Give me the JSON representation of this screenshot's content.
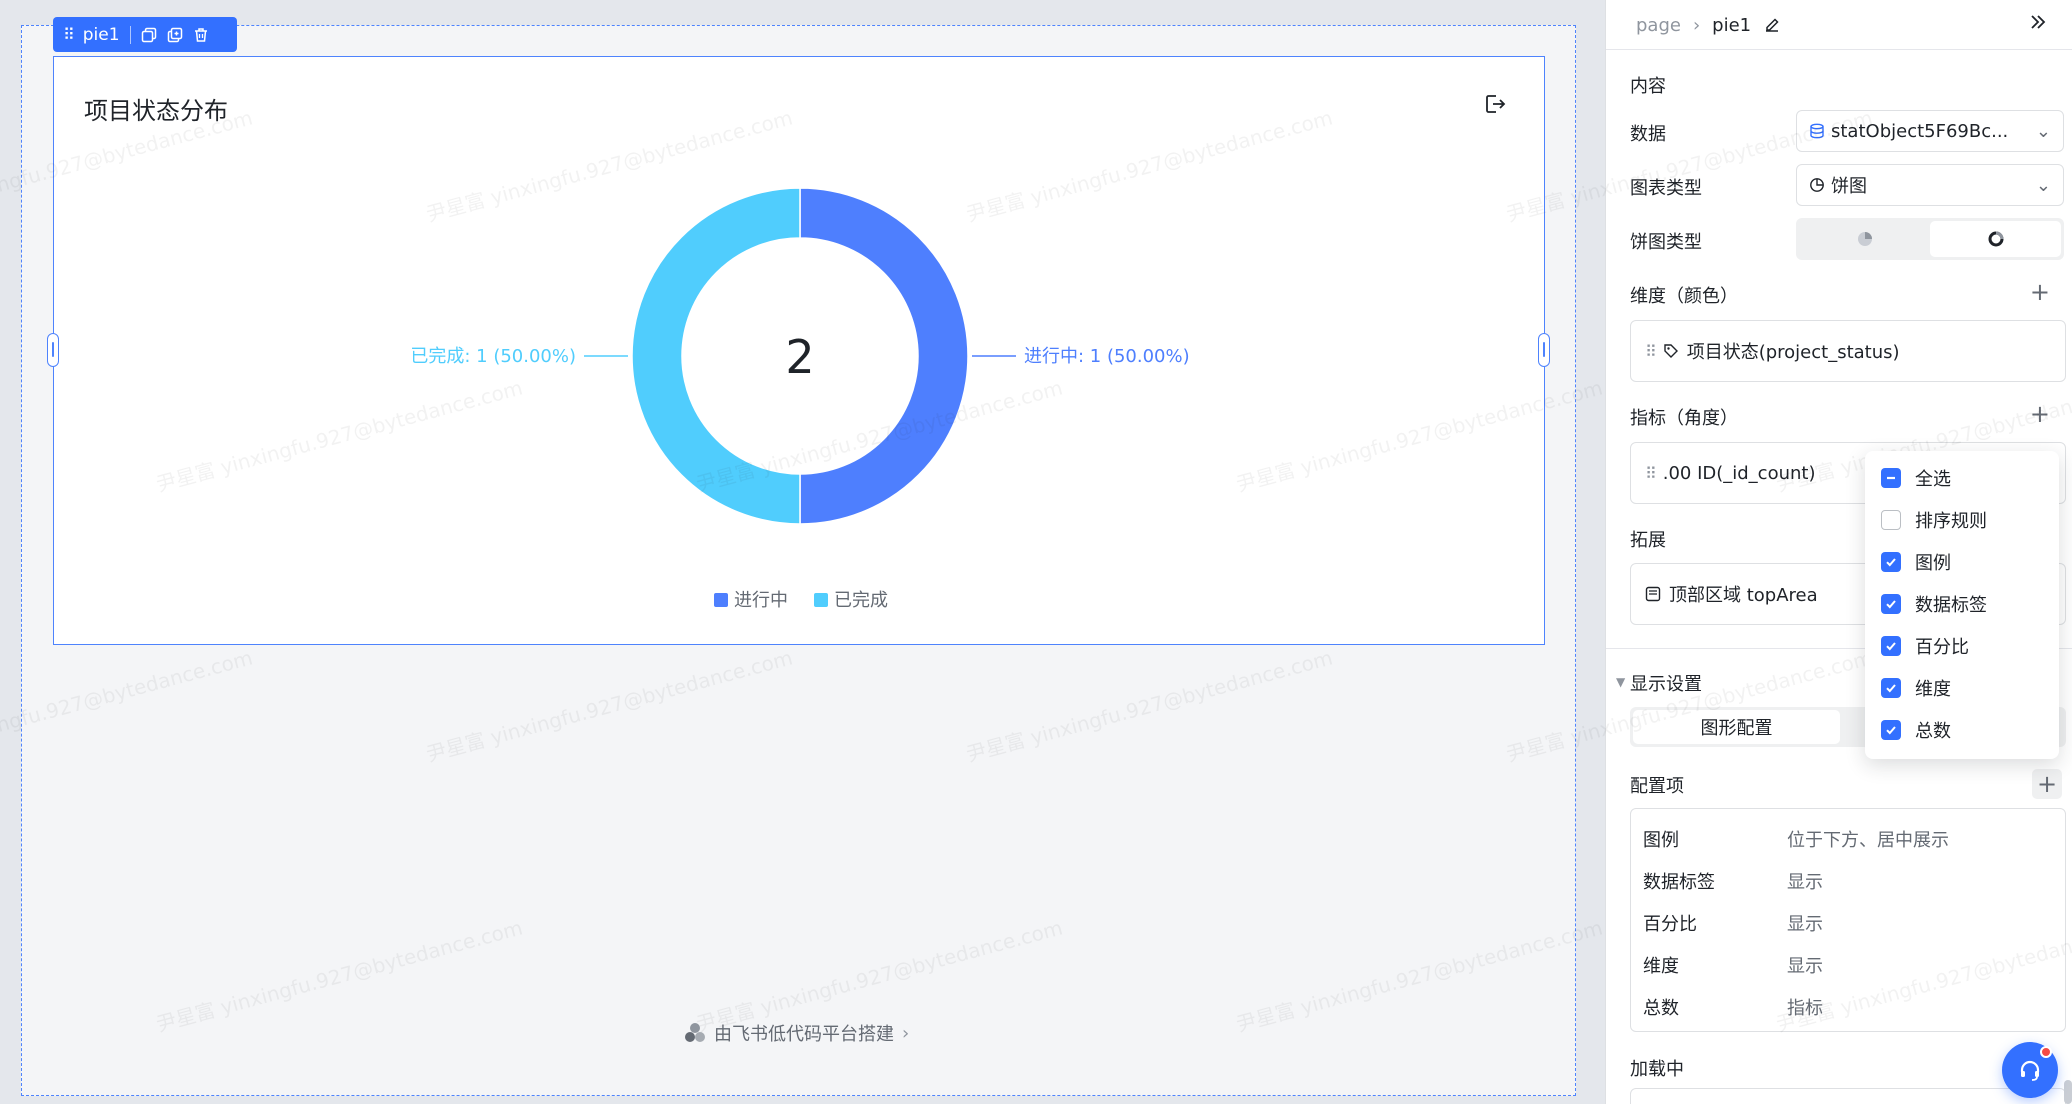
{
  "toolbar": {
    "component_name": "pie1"
  },
  "chart_card": {
    "title": "项目状态分布"
  },
  "chart_data": {
    "type": "pie",
    "title": "项目状态分布",
    "total": "2",
    "slices": [
      {
        "name": "进行中",
        "value": 1,
        "percent": 50.0,
        "label": "进行中: 1 (50.00%)",
        "color": "#4e7ffe"
      },
      {
        "name": "已完成",
        "value": 1,
        "percent": 50.0,
        "label": "已完成: 1 (50.00%)",
        "color": "#50cdfd"
      }
    ],
    "legend": [
      "进行中",
      "已完成"
    ],
    "legend_position": "bottom-center"
  },
  "footer": {
    "brand": "由飞书低代码平台搭建"
  },
  "watermark": {
    "text": "尹星富 yinxingfu.927@bytedance.com"
  },
  "panel": {
    "breadcrumb": {
      "root": "page",
      "current": "pie1"
    },
    "section_content": "内容",
    "data_label": "数据",
    "data_value": "statObject5F69Bc...",
    "chart_type_label": "图表类型",
    "chart_type_value": "饼图",
    "pie_type_label": "饼图类型",
    "dimension_label": "维度（颜色）",
    "dimension_field": "项目状态(project_status)",
    "metric_label": "指标（角度）",
    "metric_field": ".00 ID(_id_count)",
    "extend_label": "拓展",
    "extend_field": "顶部区域 topArea",
    "display_settings": "显示设置",
    "tab_graph": "图形配置",
    "config_label": "配置项",
    "config_rows": [
      {
        "k": "图例",
        "v": "位于下方、居中展示"
      },
      {
        "k": "数据标签",
        "v": "显示"
      },
      {
        "k": "百分比",
        "v": "显示"
      },
      {
        "k": "维度",
        "v": "显示"
      },
      {
        "k": "总数",
        "v": "指标"
      }
    ],
    "loading": "加载中"
  },
  "dropdown": {
    "items": [
      {
        "label": "全选",
        "state": "partial"
      },
      {
        "label": "排序规则",
        "state": "off"
      },
      {
        "label": "图例",
        "state": "on"
      },
      {
        "label": "数据标签",
        "state": "on"
      },
      {
        "label": "百分比",
        "state": "on"
      },
      {
        "label": "维度",
        "state": "on"
      },
      {
        "label": "总数",
        "state": "on"
      }
    ]
  },
  "colors": {
    "accent": "#3370ff",
    "slice_blue": "#4e7ffe",
    "slice_cyan": "#50cdfd"
  }
}
